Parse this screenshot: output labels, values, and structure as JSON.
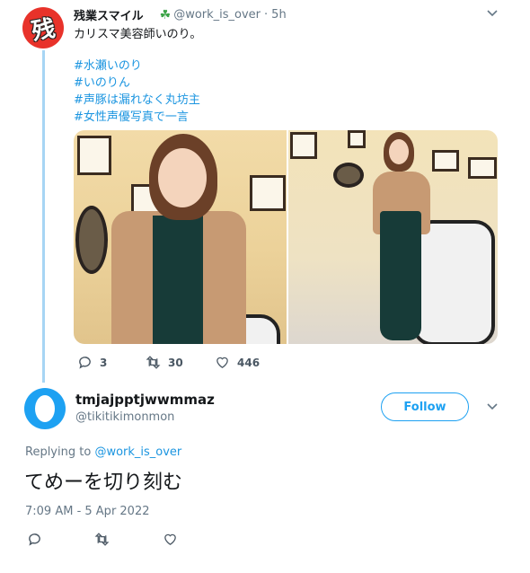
{
  "tweet1": {
    "name": "残業スマイル",
    "handle": "@work_is_over",
    "separator": "·",
    "time": "5h",
    "body": "カリスマ美容師いのり。",
    "hashtags": [
      "#水瀬いのり",
      "#いのりん",
      "#声豚は漏れなく丸坊主",
      "#女性声優写真で一言"
    ],
    "avatar_text": "残",
    "counts": {
      "replies": "3",
      "retweets": "30",
      "likes": "446"
    }
  },
  "tweet2": {
    "name": "tmjajpptjwwmmaz",
    "handle": "@tikitikimonmon",
    "follow_label": "Follow",
    "replying_prefix": "Replying to",
    "replying_handle": "@work_is_over",
    "body": "てめーを切り刻む",
    "timestamp": "7:09 AM - 5 Apr 2022"
  },
  "icons": {
    "reply": "reply-icon",
    "retweet": "retweet-icon",
    "like": "heart-icon",
    "more": "chevron-down-icon",
    "badge": "shamrock-icon"
  },
  "colors": {
    "accent": "#1da1f2",
    "link": "#1b95e0",
    "muted": "#657786",
    "thread_line": "#a7d5f4",
    "avatar_red": "#e8322a"
  }
}
